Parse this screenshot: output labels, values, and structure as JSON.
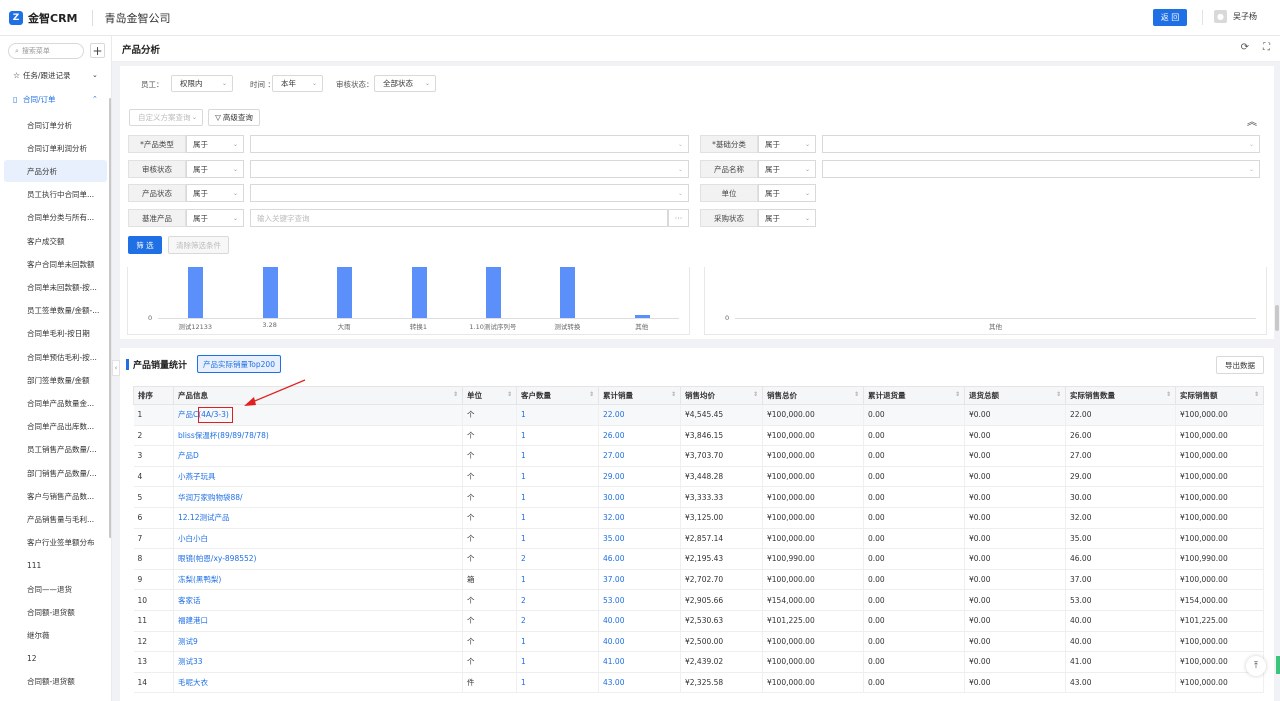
{
  "header": {
    "logo_mark": "Z",
    "app_name": "金智CRM",
    "company": "青岛金智公司",
    "back_label": "返 回",
    "avatar_glyph": "👤",
    "user_name": "吴子杨"
  },
  "sidebar": {
    "search_placeholder": "搜索菜单",
    "plus_label": "+",
    "groups": [
      {
        "label": "任务/跟进记录",
        "icon": "pin-icon"
      },
      {
        "label": "合同/订单",
        "icon": "document-icon"
      }
    ],
    "items": [
      "合同订单分析",
      "合同订单利润分析",
      "产品分析",
      "员工执行中合同单...",
      "合同单分类与所有...",
      "客户成交额",
      "客户合同单未回款额",
      "合同单未回款额-按...",
      "员工签单数量/金额-...",
      "合同单毛利-按日期",
      "合同单预估毛利-按...",
      "部门签单数量/金额",
      "合同单产品数量金...",
      "合同单产品出库数...",
      "员工销售产品数量/...",
      "部门销售产品数量/...",
      "客户与销售产品数...",
      "产品销售量与毛利...",
      "客户行业签单额分布",
      "111",
      "合同——退货",
      "合同额-退货额",
      "继尔薇",
      "12",
      "合同额-退货额"
    ]
  },
  "page": {
    "title": "产品分析"
  },
  "filters": {
    "employee_label": "员工：",
    "employee_value": "权限内",
    "time_label": "时间 ：",
    "time_value": "本年",
    "audit_label": "审核状态：",
    "audit_value": "全部状态",
    "scheme_placeholder": "自定义方案查询",
    "advanced_label": "高级查询",
    "conditions_left": [
      {
        "label": "*产品类型",
        "op": "属于",
        "placeholder": ""
      },
      {
        "label": "审核状态",
        "op": "属于",
        "placeholder": ""
      },
      {
        "label": "产品状态",
        "op": "属于",
        "placeholder": ""
      },
      {
        "label": "基准产品",
        "op": "属于",
        "placeholder": "输入关键字查询"
      }
    ],
    "conditions_right": [
      {
        "label": "*基础分类",
        "op": "属于"
      },
      {
        "label": "产品名称",
        "op": "属于"
      },
      {
        "label": "单位",
        "op": "属于"
      },
      {
        "label": "采购状态",
        "op": "属于"
      }
    ],
    "ellipsis": "···",
    "filter_btn": "筛 选",
    "clear_btn": "清除筛选条件"
  },
  "chart_data": [
    {
      "type": "bar",
      "title": "",
      "categories": [
        "测试12133",
        "3.28",
        "大雨",
        "转换1",
        "1.10测试序列号",
        "测试转换",
        "其他"
      ],
      "values": [
        100000,
        100000,
        100000,
        100000,
        100000,
        100000,
        5000
      ],
      "zero_label": "0",
      "color": "#5b8ff9"
    },
    {
      "type": "bar",
      "title": "",
      "categories": [
        "其他"
      ],
      "values": [
        0
      ],
      "zero_label": "0"
    }
  ],
  "section": {
    "title": "产品销量统计",
    "top_btn": "产品实际销量Top200",
    "export_btn": "导出数据"
  },
  "table": {
    "columns": [
      "排序",
      "产品信息",
      "单位",
      "客户数量",
      "累计销量",
      "销售均价",
      "销售总价",
      "累计退货量",
      "退货总额",
      "实际销售数量",
      "实际销售额"
    ],
    "rows": [
      [
        "1",
        "产品C(4A/3-3)",
        "个",
        "1",
        "22.00",
        "¥4,545.45",
        "¥100,000.00",
        "0.00",
        "¥0.00",
        "22.00",
        "¥100,000.00"
      ],
      [
        "2",
        "bliss保温杯(89/89/78/78)",
        "个",
        "1",
        "26.00",
        "¥3,846.15",
        "¥100,000.00",
        "0.00",
        "¥0.00",
        "26.00",
        "¥100,000.00"
      ],
      [
        "3",
        "产品D",
        "个",
        "1",
        "27.00",
        "¥3,703.70",
        "¥100,000.00",
        "0.00",
        "¥0.00",
        "27.00",
        "¥100,000.00"
      ],
      [
        "4",
        "小燕子玩具",
        "个",
        "1",
        "29.00",
        "¥3,448.28",
        "¥100,000.00",
        "0.00",
        "¥0.00",
        "29.00",
        "¥100,000.00"
      ],
      [
        "5",
        "华润万家购物袋88/",
        "个",
        "1",
        "30.00",
        "¥3,333.33",
        "¥100,000.00",
        "0.00",
        "¥0.00",
        "30.00",
        "¥100,000.00"
      ],
      [
        "6",
        "12.12测试产品",
        "个",
        "1",
        "32.00",
        "¥3,125.00",
        "¥100,000.00",
        "0.00",
        "¥0.00",
        "32.00",
        "¥100,000.00"
      ],
      [
        "7",
        "小白小白",
        "个",
        "1",
        "35.00",
        "¥2,857.14",
        "¥100,000.00",
        "0.00",
        "¥0.00",
        "35.00",
        "¥100,000.00"
      ],
      [
        "8",
        "眼镜(帕恩/xy-898552)",
        "个",
        "2",
        "46.00",
        "¥2,195.43",
        "¥100,990.00",
        "0.00",
        "¥0.00",
        "46.00",
        "¥100,990.00"
      ],
      [
        "9",
        "冻梨(黑鸭梨)",
        "箱",
        "1",
        "37.00",
        "¥2,702.70",
        "¥100,000.00",
        "0.00",
        "¥0.00",
        "37.00",
        "¥100,000.00"
      ],
      [
        "10",
        "客家话",
        "个",
        "2",
        "53.00",
        "¥2,905.66",
        "¥154,000.00",
        "0.00",
        "¥0.00",
        "53.00",
        "¥154,000.00"
      ],
      [
        "11",
        "福建港口",
        "个",
        "2",
        "40.00",
        "¥2,530.63",
        "¥101,225.00",
        "0.00",
        "¥0.00",
        "40.00",
        "¥101,225.00"
      ],
      [
        "12",
        "测试9",
        "个",
        "1",
        "40.00",
        "¥2,500.00",
        "¥100,000.00",
        "0.00",
        "¥0.00",
        "40.00",
        "¥100,000.00"
      ],
      [
        "13",
        "测试33",
        "个",
        "1",
        "41.00",
        "¥2,439.02",
        "¥100,000.00",
        "0.00",
        "¥0.00",
        "41.00",
        "¥100,000.00"
      ],
      [
        "14",
        "毛呢大衣",
        "件",
        "1",
        "43.00",
        "¥2,325.58",
        "¥100,000.00",
        "0.00",
        "¥0.00",
        "43.00",
        "¥100,000.00"
      ]
    ]
  }
}
